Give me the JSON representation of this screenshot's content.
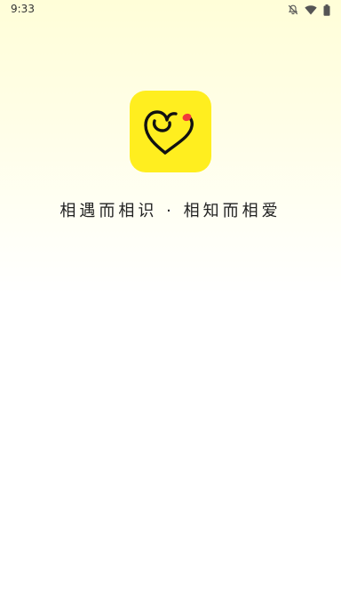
{
  "status_bar": {
    "time": "9:33",
    "icons": [
      "notifications-off-icon",
      "wifi-icon",
      "battery-icon"
    ]
  },
  "splash": {
    "logo_icon": "heart-logo-icon",
    "slogan": "相遇而相识 · 相知而相爱"
  },
  "colors": {
    "logo_background": "#FFEE1F",
    "logo_stroke": "#111111",
    "logo_accent": "#F23A3A",
    "background_top": "#FFFED8",
    "background_bottom": "#FFFFFF"
  }
}
